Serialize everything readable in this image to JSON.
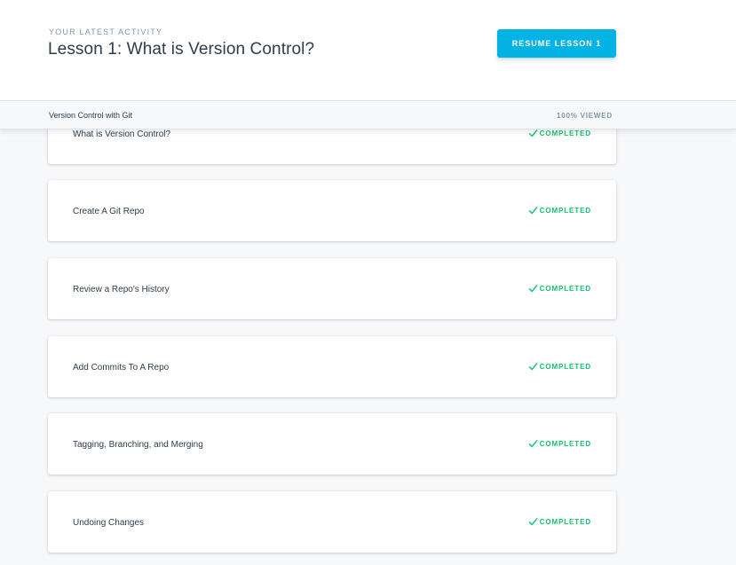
{
  "activity": {
    "eyebrow": "YOUR LATEST ACTIVITY",
    "title": "Lesson 1: What is Version Control?",
    "resume_label": "RESUME LESSON 1"
  },
  "course_bar": {
    "name": "Version Control with Git",
    "progress": "100% VIEWED"
  },
  "lessons": [
    {
      "title": "What is Version Control?",
      "status": "COMPLETED"
    },
    {
      "title": "Create A Git Repo",
      "status": "COMPLETED"
    },
    {
      "title": "Review a Repo's History",
      "status": "COMPLETED"
    },
    {
      "title": "Add Commits To A Repo",
      "status": "COMPLETED"
    },
    {
      "title": "Tagging, Branching, and Merging",
      "status": "COMPLETED"
    },
    {
      "title": "Undoing Changes",
      "status": "COMPLETED"
    }
  ],
  "colors": {
    "accent": "#02b3e4",
    "completed": "#15c26b",
    "text": "#2e3d49",
    "muted": "#7d97ad"
  },
  "icons": {
    "status_icon": "check-icon"
  }
}
